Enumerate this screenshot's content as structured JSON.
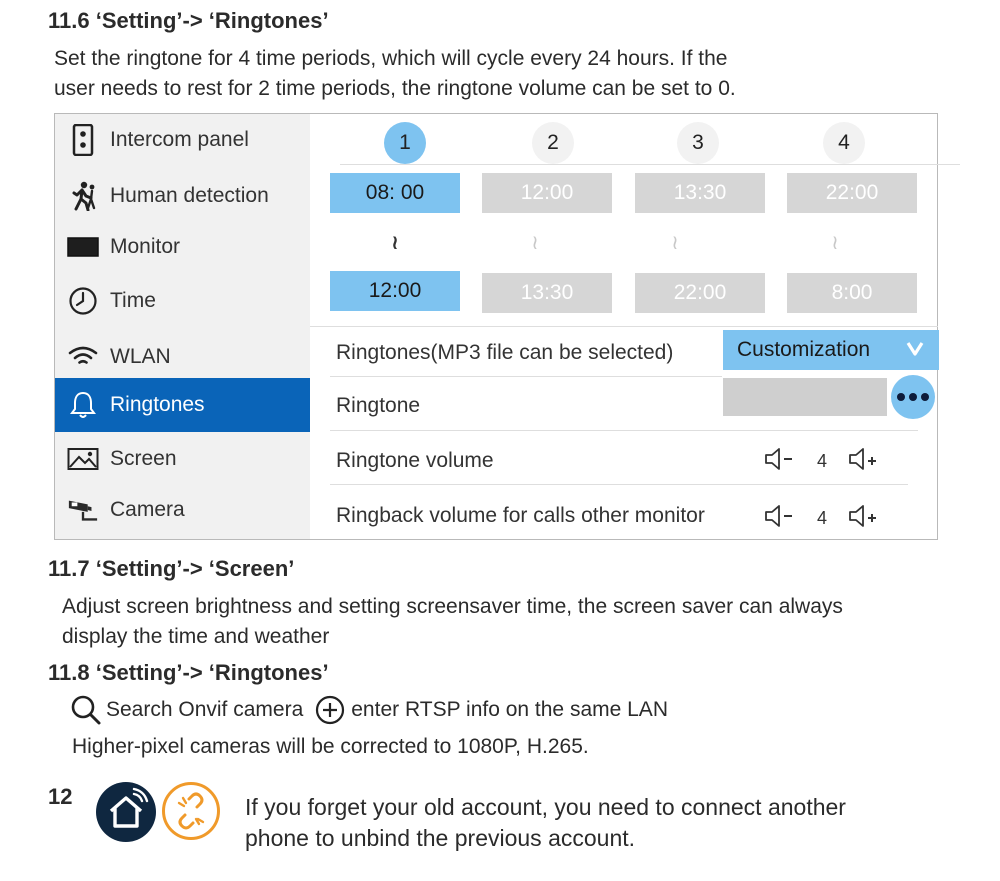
{
  "s116": {
    "heading": "11.6 ‘Setting’-> ‘Ringtones’",
    "line1": "Set the ringtone for 4 time periods, which will cycle every 24 hours. If the",
    "line2": "user needs to rest for 2 time periods, the ringtone volume can be set to 0."
  },
  "sidebar": {
    "items": [
      {
        "label": "Intercom panel",
        "icon": "intercom-icon"
      },
      {
        "label": "Human detection",
        "icon": "walking-person-icon"
      },
      {
        "label": "Monitor",
        "icon": "monitor-icon"
      },
      {
        "label": "Time",
        "icon": "clock-icon"
      },
      {
        "label": "WLAN",
        "icon": "wifi-icon"
      },
      {
        "label": "Ringtones",
        "icon": "bell-icon"
      },
      {
        "label": "Screen",
        "icon": "image-icon"
      },
      {
        "label": "Camera",
        "icon": "cctv-camera-icon"
      }
    ],
    "active": "Ringtones",
    "active_color": "#0a64b8"
  },
  "periods": {
    "numbers": [
      "1",
      "2",
      "3",
      "4"
    ],
    "starts": [
      "08: 00",
      "12:00",
      "13:30",
      "22:00"
    ],
    "ends": [
      "12:00",
      "13:30",
      "22:00",
      "8:00"
    ],
    "separator": "≀",
    "active_index": 0,
    "active_color": "#7ec3f0"
  },
  "settings": {
    "ringtones_label": "Ringtones(MP3 file can be selected)",
    "ringtones_value": "Customization",
    "ringtone_label": "Ringtone",
    "ringtone_volume_label": "Ringtone volume",
    "ringtone_volume_value": "4",
    "ringback_label": "Ringback volume for calls other monitor",
    "ringback_volume_value": "4"
  },
  "s117": {
    "heading": "11.7 ‘Setting’-> ‘Screen’",
    "line1": "Adjust screen brightness and setting screensaver time, the screen saver can always",
    "line2": "display the time and weather"
  },
  "s118": {
    "heading": "11.8 ‘Setting’-> ‘Ringtones’",
    "search_text": "Search Onvif camera",
    "add_text": "enter RTSP info on the same LAN",
    "line2": "Higher-pixel cameras will be corrected to 1080P, H.265."
  },
  "s12": {
    "number": "12",
    "line1": "If you forget your old account, you need to connect another",
    "line2": "phone to unbind the previous account."
  }
}
